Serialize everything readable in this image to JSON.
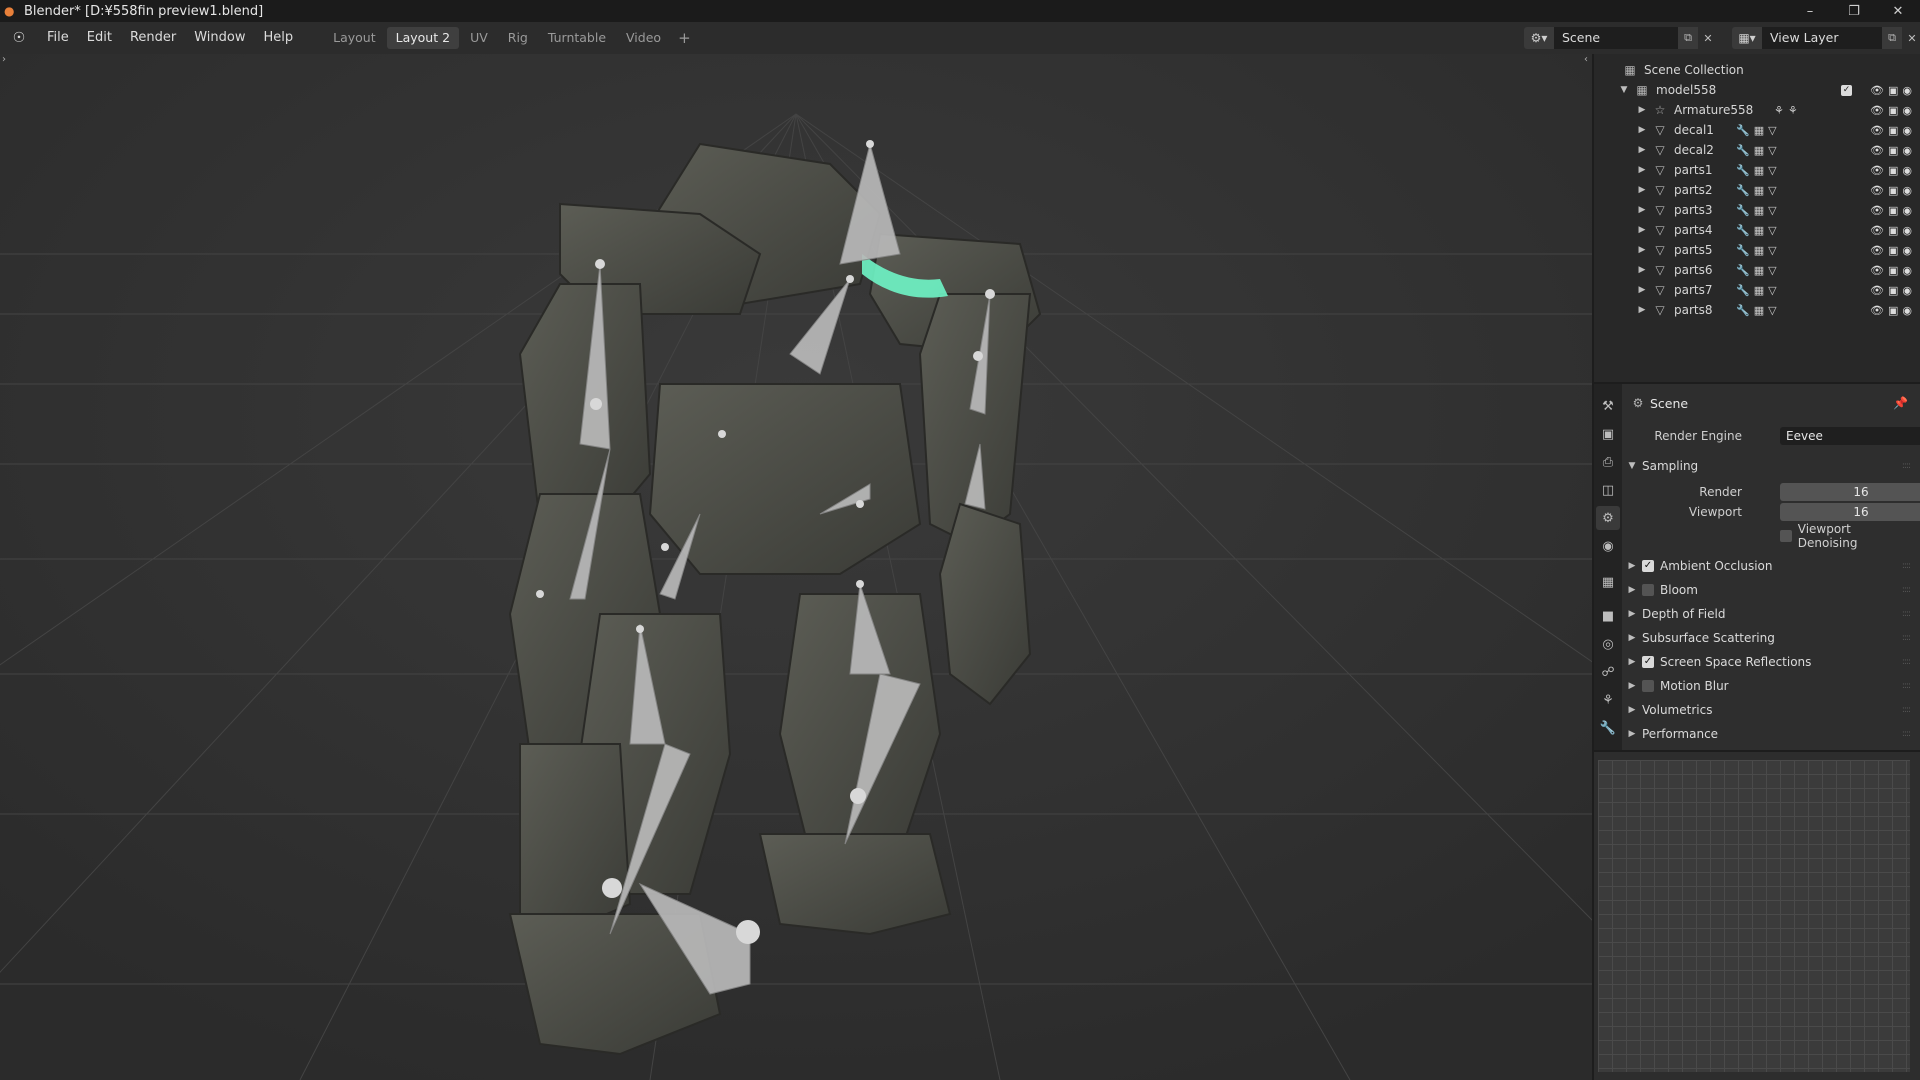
{
  "window": {
    "title": "Blender* [D:¥558fin preview1.blend]"
  },
  "menu": [
    "File",
    "Edit",
    "Render",
    "Window",
    "Help"
  ],
  "workspaces": {
    "tabs": [
      "Layout",
      "Layout 2",
      "UV",
      "Rig",
      "Turntable",
      "Video"
    ],
    "active": "Layout 2",
    "add": "+"
  },
  "scene_selector": {
    "value": "Scene"
  },
  "view_layer_selector": {
    "value": "View Layer"
  },
  "outliner": {
    "root": "Scene Collection",
    "collection": "model558",
    "items": [
      "Armature558",
      "decal1",
      "decal2",
      "parts1",
      "parts2",
      "parts3",
      "parts4",
      "parts5",
      "parts6",
      "parts7",
      "parts8"
    ]
  },
  "properties": {
    "context": "Scene",
    "render_engine_label": "Render Engine",
    "render_engine": "Eevee",
    "sampling": {
      "title": "Sampling",
      "render_label": "Render",
      "render": "16",
      "viewport_label": "Viewport",
      "viewport": "16",
      "denoise_label": "Viewport Denoising"
    },
    "sections": [
      {
        "label": "Ambient Occlusion",
        "checkbox": true,
        "checked": true
      },
      {
        "label": "Bloom",
        "checkbox": true,
        "checked": false
      },
      {
        "label": "Depth of Field",
        "checkbox": false
      },
      {
        "label": "Subsurface Scattering",
        "checkbox": false
      },
      {
        "label": "Screen Space Reflections",
        "checkbox": true,
        "checked": true
      },
      {
        "label": "Motion Blur",
        "checkbox": true,
        "checked": false
      },
      {
        "label": "Volumetrics",
        "checkbox": false
      },
      {
        "label": "Performance",
        "checkbox": false
      }
    ]
  },
  "colors": {
    "accent": "#e8803a",
    "viewport_bg": "#383838",
    "eye_glow": "#6ff5c6"
  }
}
